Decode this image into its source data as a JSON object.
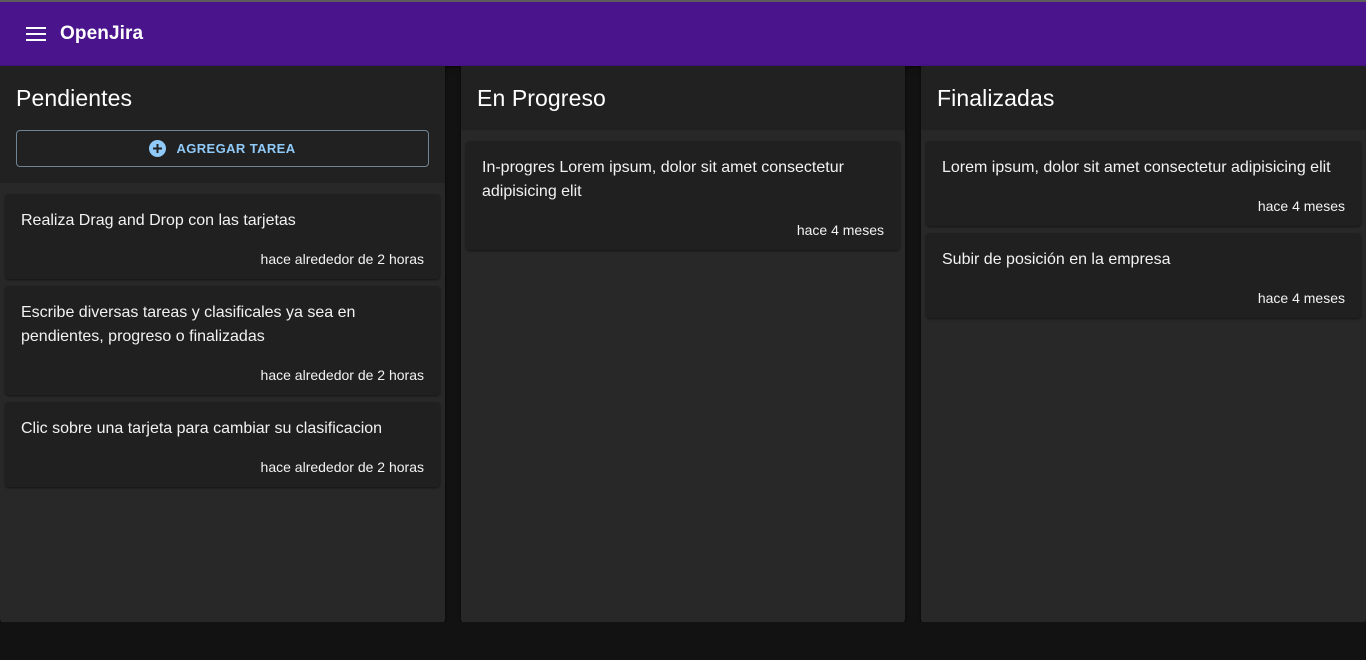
{
  "app": {
    "title": "OpenJira",
    "menu_icon": "hamburger-menu-icon",
    "brand_color": "#4a148c"
  },
  "columns": [
    {
      "title": "Pendientes",
      "add_button": {
        "label": "AGREGAR TAREA",
        "icon": "add-circle-icon"
      },
      "cards": [
        {
          "text": "Realiza Drag and Drop con las tarjetas",
          "time": "hace alrededor de 2 horas"
        },
        {
          "text": "Escribe diversas tareas y clasificales ya sea en pendientes, progreso o finalizadas",
          "time": "hace alrededor de 2 horas"
        },
        {
          "text": "Clic sobre una tarjeta para cambiar su clasificacion",
          "time": "hace alrededor de 2 horas"
        }
      ]
    },
    {
      "title": "En Progreso",
      "cards": [
        {
          "text": "In-progres Lorem ipsum, dolor sit amet consectetur adipisicing elit",
          "time": "hace 4 meses"
        }
      ]
    },
    {
      "title": "Finalizadas",
      "cards": [
        {
          "text": "Lorem ipsum, dolor sit amet consectetur adipisicing elit",
          "time": "hace 4 meses"
        },
        {
          "text": "Subir de posición en la empresa",
          "time": "hace 4 meses"
        }
      ]
    }
  ]
}
